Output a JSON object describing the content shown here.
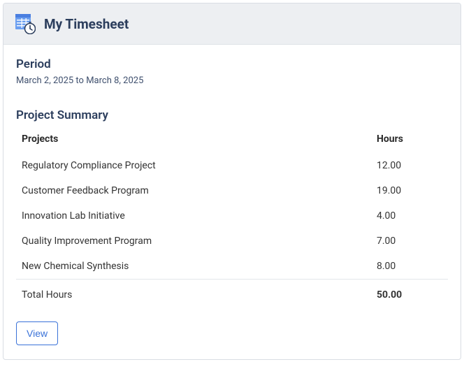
{
  "header": {
    "title": "My Timesheet"
  },
  "period": {
    "label": "Period",
    "text": "March 2, 2025 to March 8, 2025"
  },
  "summary": {
    "title": "Project Summary",
    "columns": {
      "project": "Projects",
      "hours": "Hours"
    },
    "rows": [
      {
        "project": "Regulatory Compliance Project",
        "hours": "12.00"
      },
      {
        "project": "Customer Feedback Program",
        "hours": "19.00"
      },
      {
        "project": "Innovation Lab Initiative",
        "hours": "4.00"
      },
      {
        "project": "Quality Improvement Program",
        "hours": "7.00"
      },
      {
        "project": "New Chemical Synthesis",
        "hours": "8.00"
      }
    ],
    "total": {
      "label": "Total Hours",
      "hours": "50.00"
    }
  },
  "actions": {
    "view": "View"
  }
}
